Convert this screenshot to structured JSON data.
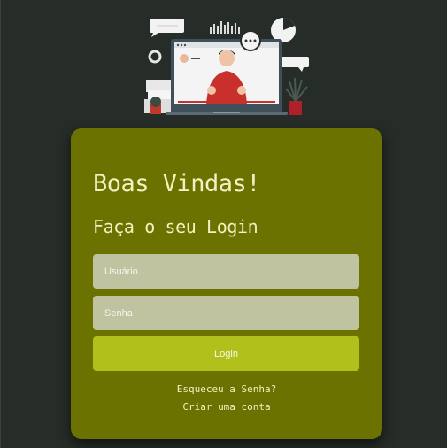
{
  "illustration": {
    "icon": "video-call-illustration-icon"
  },
  "login_card": {
    "title": "Boas Vindas!",
    "subtitle": "Faça o seu Login",
    "username_placeholder": "Usuário",
    "password_placeholder": "Senha",
    "login_button_label": "Login",
    "forgot_password_link": "Esqueceu a Senha?",
    "create_account_link": "Criar uma conta"
  },
  "colors": {
    "page_background": "#262c27",
    "card_background": "#6b7200",
    "input_background": "#bfc3a0",
    "button_background": "#b1c01a",
    "text_color": "#f3f0c2"
  }
}
